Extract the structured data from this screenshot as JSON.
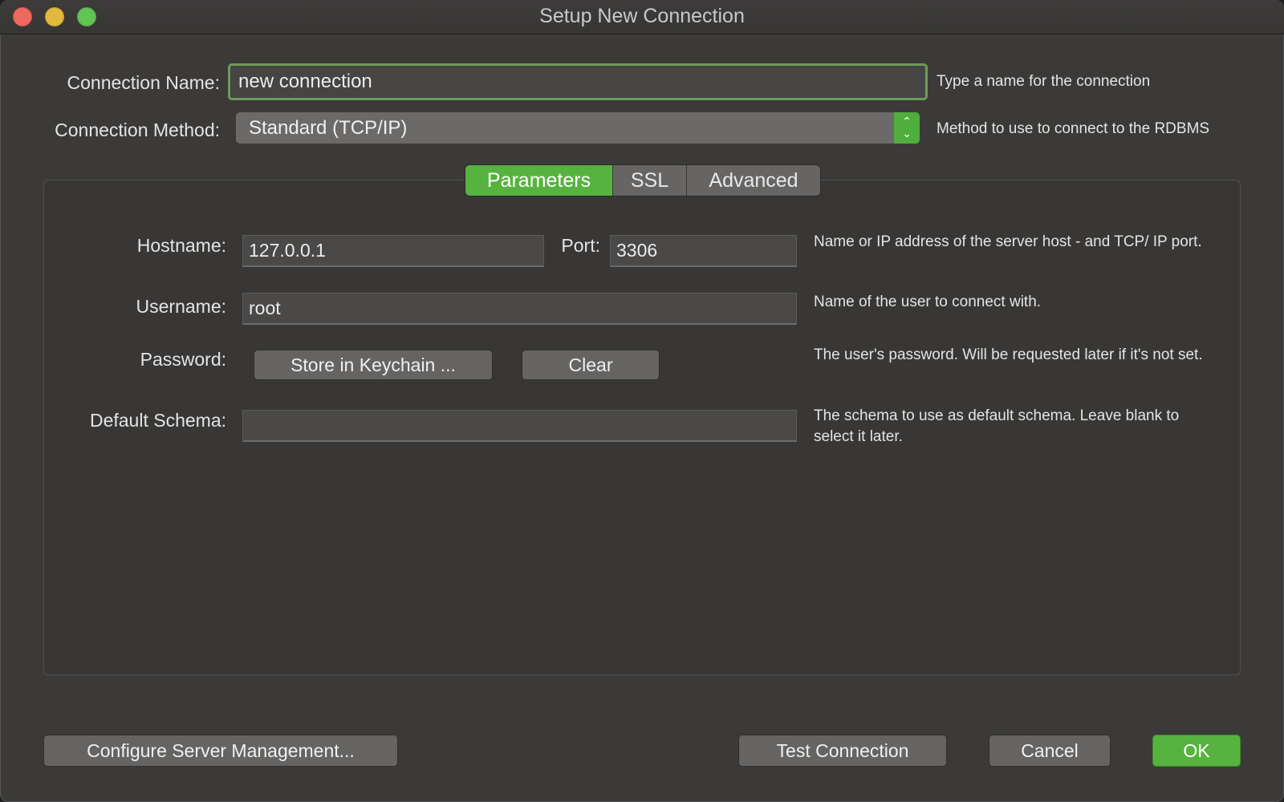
{
  "window": {
    "title": "Setup New Connection"
  },
  "connection": {
    "name_label": "Connection Name:",
    "name_value": "new connection",
    "name_hint": "Type a name for the connection",
    "method_label": "Connection Method:",
    "method_value": "Standard (TCP/IP)",
    "method_hint": "Method to use to connect to the RDBMS"
  },
  "tabs": [
    {
      "label": "Parameters",
      "active": true
    },
    {
      "label": "SSL",
      "active": false
    },
    {
      "label": "Advanced",
      "active": false
    }
  ],
  "parameters": {
    "hostname_label": "Hostname:",
    "hostname_value": "127.0.0.1",
    "port_label": "Port:",
    "port_value": "3306",
    "host_hint": "Name or IP address of the server host - and TCP/ IP port.",
    "username_label": "Username:",
    "username_value": "root",
    "username_hint": "Name of the user to connect with.",
    "password_label": "Password:",
    "store_keychain_label": "Store in Keychain ...",
    "clear_label": "Clear",
    "password_hint": "The user's password. Will be requested later if it's not set.",
    "schema_label": "Default Schema:",
    "schema_value": "",
    "schema_hint": "The schema to use as default schema. Leave blank to select it later."
  },
  "footer": {
    "configure_label": "Configure Server Management...",
    "test_label": "Test Connection",
    "cancel_label": "Cancel",
    "ok_label": "OK"
  },
  "colors": {
    "accent_green": "#57b33f",
    "window_bg": "#3b3a39"
  }
}
